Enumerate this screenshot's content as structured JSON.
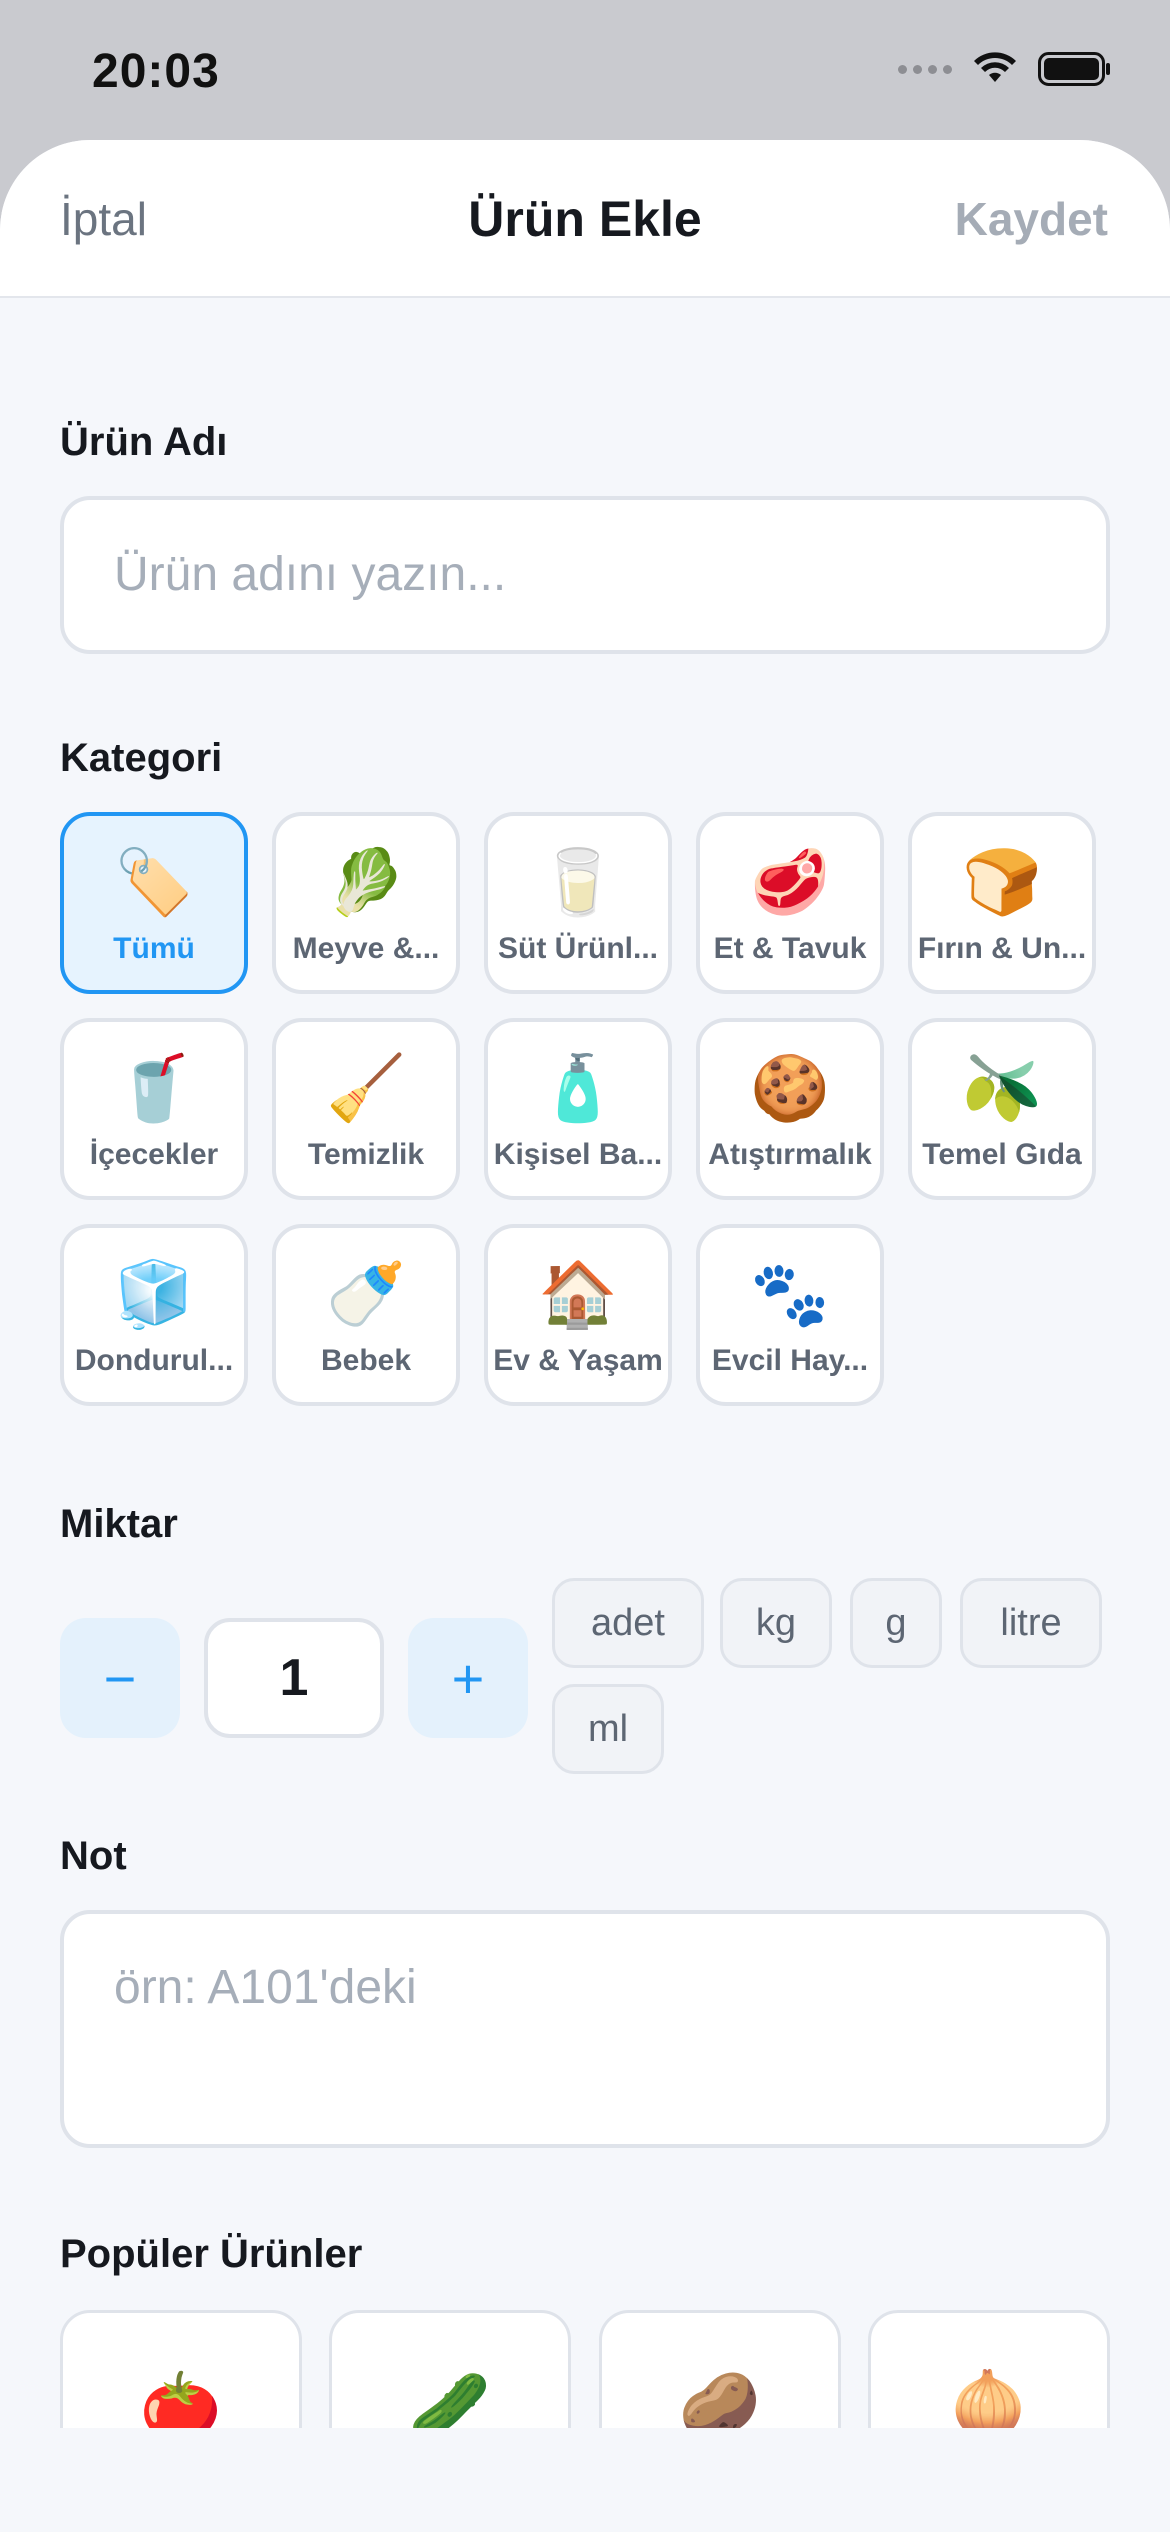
{
  "status_bar": {
    "time": "20:03"
  },
  "header": {
    "cancel_label": "İptal",
    "title": "Ürün Ekle",
    "save_label": "Kaydet"
  },
  "product_name": {
    "label": "Ürün Adı",
    "placeholder": "Ürün adını yazın...",
    "value": ""
  },
  "category": {
    "label": "Kategori",
    "selected": "Tümü",
    "items": [
      {
        "label": "Tümü",
        "icon": "🏷️",
        "icon_name": "tag-icon"
      },
      {
        "label": "Meyve &...",
        "icon": "🥬",
        "icon_name": "leafy-green-icon"
      },
      {
        "label": "Süt Ürünl...",
        "icon": "🥛",
        "icon_name": "milk-glass-icon"
      },
      {
        "label": "Et & Tavuk",
        "icon": "🥩",
        "icon_name": "meat-icon"
      },
      {
        "label": "Fırın & Un...",
        "icon": "🍞",
        "icon_name": "bread-icon"
      },
      {
        "label": "İçecekler",
        "icon": "🥤",
        "icon_name": "cup-straw-icon"
      },
      {
        "label": "Temizlik",
        "icon": "🧹",
        "icon_name": "broom-icon"
      },
      {
        "label": "Kişisel Ba...",
        "icon": "🧴",
        "icon_name": "lotion-bottle-icon"
      },
      {
        "label": "Atıştırmalık",
        "icon": "🍪",
        "icon_name": "cookie-icon"
      },
      {
        "label": "Temel Gıda",
        "icon": "🫒",
        "icon_name": "olive-icon"
      },
      {
        "label": "Dondurul...",
        "icon": "🧊",
        "icon_name": "ice-cube-icon"
      },
      {
        "label": "Bebek",
        "icon": "🍼",
        "icon_name": "baby-bottle-icon"
      },
      {
        "label": "Ev & Yaşam",
        "icon": "🏠",
        "icon_name": "house-icon"
      },
      {
        "label": "Evcil Hay...",
        "icon": "🐾",
        "icon_name": "paw-prints-icon"
      }
    ]
  },
  "quantity": {
    "label": "Miktar",
    "value": "1",
    "minus": "−",
    "plus": "+",
    "units": [
      "adet",
      "kg",
      "g",
      "litre",
      "ml"
    ]
  },
  "note": {
    "label": "Not",
    "placeholder": "örn: A101'deki",
    "value": ""
  },
  "popular": {
    "label": "Popüler Ürünler",
    "items": [
      {
        "icon": "🍅",
        "icon_name": "tomato-icon"
      },
      {
        "icon": "🥒",
        "icon_name": "cucumber-icon"
      },
      {
        "icon": "🥔",
        "icon_name": "potato-icon"
      },
      {
        "icon": "🧅",
        "icon_name": "onion-icon"
      }
    ]
  },
  "colors": {
    "accent": "#2196f3",
    "accent_bg": "#e6f3fe",
    "background": "#f5f7fb",
    "muted": "#a6aeb9"
  }
}
